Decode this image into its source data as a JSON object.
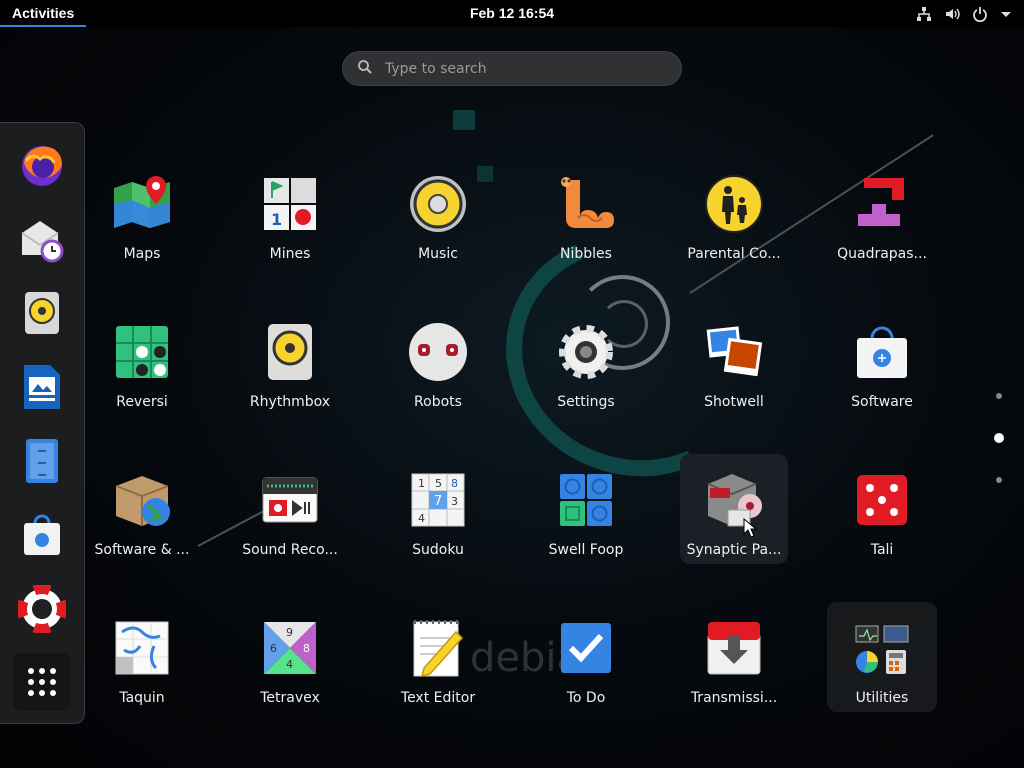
{
  "topbar": {
    "activities": "Activities",
    "clock": "Feb 12  16:54",
    "icons": [
      "network-icon",
      "volume-icon",
      "power-icon",
      "menu-arrow-icon"
    ]
  },
  "search": {
    "placeholder": "Type to search"
  },
  "dash": {
    "items": [
      {
        "name": "Firefox",
        "icon": "firefox-icon"
      },
      {
        "name": "Evolution",
        "icon": "mail-clock-icon"
      },
      {
        "name": "Rhythmbox",
        "icon": "speaker-icon"
      },
      {
        "name": "LibreOffice Impress",
        "icon": "presentation-icon"
      },
      {
        "name": "Files",
        "icon": "file-cabinet-icon"
      },
      {
        "name": "Software",
        "icon": "shopping-bag-icon"
      },
      {
        "name": "Help",
        "icon": "lifebuoy-icon"
      },
      {
        "name": "Show Applications",
        "icon": "app-grid-icon"
      }
    ]
  },
  "apps": {
    "row1": [
      "Maps",
      "Mines",
      "Music",
      "Nibbles",
      "Parental Co...",
      "Quadrapas..."
    ],
    "row2": [
      "Reversi",
      "Rhythmbox",
      "Robots",
      "Settings",
      "Shotwell",
      "Software"
    ],
    "row3": [
      "Software & ...",
      "Sound Reco...",
      "Sudoku",
      "Swell Foop",
      "Synaptic Pa...",
      "Tali"
    ],
    "row4": [
      "Taquin",
      "Tetravex",
      "Text Editor",
      "To Do",
      "Transmissi...",
      "Utilities"
    ]
  },
  "wallpaper": {
    "text": "debian"
  },
  "pager": {
    "pages": 3,
    "current": 2
  },
  "colors": {
    "accent": "#3584e4",
    "topbar": "#000000",
    "dash": "#1e2022"
  }
}
